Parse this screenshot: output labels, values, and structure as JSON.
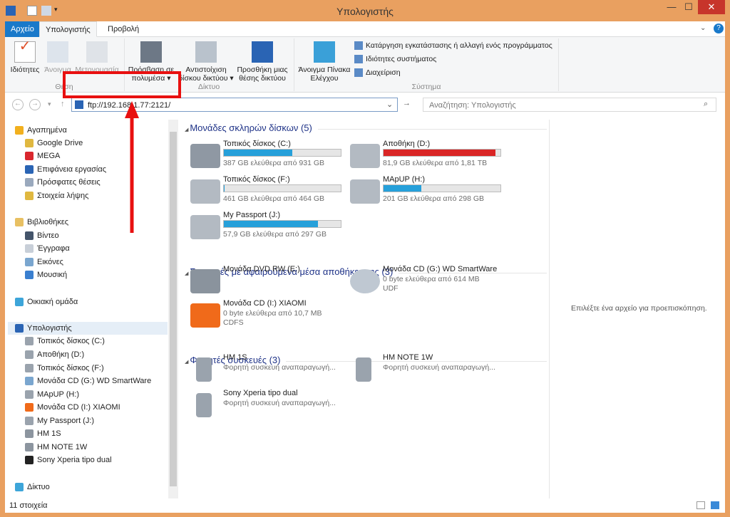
{
  "window": {
    "title": "Υπολογιστής",
    "minimize": "—",
    "maximize": "☐",
    "close": "✕"
  },
  "tabs": {
    "file": "Αρχείο",
    "computer": "Υπολογιστής",
    "view": "Προβολή"
  },
  "ribbon": {
    "location": {
      "label": "Θέση",
      "properties": "Ιδιότητες",
      "open": "Άνοιγμα",
      "rename": "Μετονομασία"
    },
    "network": {
      "label": "Δίκτυο",
      "media_1": "Πρόσβαση σε",
      "media_2": "πολυμέσα ▾",
      "map_1": "Αντιστοίχιση",
      "map_2": "δίσκου δικτύου ▾",
      "add_1": "Προσθήκη μιας",
      "add_2": "θέσης δικτύου"
    },
    "system": {
      "label": "Σύστημα",
      "cp_1": "Άνοιγμα Πίνακα",
      "cp_2": "Ελέγχου",
      "uninstall": "Κατάργηση εγκατάστασης ή αλλαγή ενός προγράμματος",
      "sysprops": "Ιδιότητες συστήματος",
      "manage": "Διαχείριση"
    }
  },
  "address": {
    "value": "ftp://192.168.1.77:2121/",
    "search_placeholder": "Αναζήτηση: Υπολογιστής"
  },
  "nav": [
    {
      "label": "Αγαπημένα",
      "icon": "star-icon",
      "color": "#f2b01e",
      "indent": 0
    },
    {
      "label": "Google Drive",
      "icon": "folder-icon",
      "color": "#e0b840",
      "indent": 1
    },
    {
      "label": "MEGA",
      "icon": "mega-icon",
      "color": "#d9272e",
      "indent": 1
    },
    {
      "label": "Επιφάνεια εργασίας",
      "icon": "desktop-icon",
      "color": "#2a64b4",
      "indent": 1
    },
    {
      "label": "Πρόσφατες θέσεις",
      "icon": "recent-icon",
      "color": "#9aa9bd",
      "indent": 1
    },
    {
      "label": "Στοιχεία λήψης",
      "icon": "downloads-icon",
      "color": "#e0b840",
      "indent": 1
    },
    {
      "label": "Βιβλιοθήκες",
      "icon": "library-icon",
      "color": "#e8c063",
      "indent": 0
    },
    {
      "label": "Βίντεο",
      "icon": "video-icon",
      "color": "#44546a",
      "indent": 1
    },
    {
      "label": "Έγγραφα",
      "icon": "documents-icon",
      "color": "#c8cfd8",
      "indent": 1
    },
    {
      "label": "Εικόνες",
      "icon": "pictures-icon",
      "color": "#7aa6cf",
      "indent": 1
    },
    {
      "label": "Μουσική",
      "icon": "music-icon",
      "color": "#3a7fcf",
      "indent": 1
    },
    {
      "label": "Οικιακή ομάδα",
      "icon": "homegroup-icon",
      "color": "#3da5d9",
      "indent": 0
    },
    {
      "label": "Υπολογιστής",
      "icon": "computer-icon",
      "color": "#2a64b4",
      "indent": 0,
      "selected": true
    },
    {
      "label": "Τοπικός δίσκος (C:)",
      "icon": "drive-icon",
      "color": "#9aa3ad",
      "indent": 1
    },
    {
      "label": "Αποθήκη (D:)",
      "icon": "drive-icon",
      "color": "#9aa3ad",
      "indent": 1
    },
    {
      "label": "Τοπικός δίσκος (F:)",
      "icon": "drive-icon",
      "color": "#9aa3ad",
      "indent": 1
    },
    {
      "label": "Μονάδα CD (G:) WD SmartWare",
      "icon": "cd-icon",
      "color": "#7aa6cf",
      "indent": 1
    },
    {
      "label": "MApUP (H:)",
      "icon": "drive-icon",
      "color": "#9aa3ad",
      "indent": 1
    },
    {
      "label": "Μονάδα CD (I:) XIAOMI",
      "icon": "xiaomi-icon",
      "color": "#f06a1a",
      "indent": 1
    },
    {
      "label": "My Passport (J:)",
      "icon": "drive-icon",
      "color": "#9aa3ad",
      "indent": 1
    },
    {
      "label": "HM 1S",
      "icon": "phone-icon",
      "color": "#8c959f",
      "indent": 1
    },
    {
      "label": "HM NOTE 1W",
      "icon": "phone-icon",
      "color": "#8c959f",
      "indent": 1
    },
    {
      "label": "Sony Xperia tipo dual",
      "icon": "phone-icon",
      "color": "#222222",
      "indent": 1
    },
    {
      "label": "Δίκτυο",
      "icon": "network-icon",
      "color": "#3da5d9",
      "indent": 0
    }
  ],
  "sections": [
    {
      "title": "Μονάδες σκληρών δίσκων (5)",
      "items": [
        {
          "name": "Τοπικός δίσκος (C:)",
          "sub": "387 GB ελεύθερα από 931 GB",
          "used": 0.584,
          "bar": "#26a0da",
          "icon": "windows-drive-icon"
        },
        {
          "name": "Αποθήκη (D:)",
          "sub": "81,9 GB ελεύθερα από 1,81 TB",
          "used": 0.956,
          "bar": "#da2626",
          "icon": "drive-icon"
        },
        {
          "name": "Τοπικός δίσκος (F:)",
          "sub": "461 GB ελεύθερα από 464 GB",
          "used": 0.006,
          "bar": "#26a0da",
          "icon": "drive-icon"
        },
        {
          "name": "MApUP (H:)",
          "sub": "201 GB ελεύθερα από 298 GB",
          "used": 0.326,
          "bar": "#26a0da",
          "icon": "drive-icon"
        },
        {
          "name": "My Passport (J:)",
          "sub": "57,9 GB ελεύθερα από 297 GB",
          "used": 0.805,
          "bar": "#26a0da",
          "icon": "drive-icon"
        }
      ]
    },
    {
      "title": "Συσκευές με αφαιρούμενα μέσα αποθήκευσης (3)",
      "items": [
        {
          "name": "Μονάδα DVD RW (E:)",
          "icon": "dvd-icon"
        },
        {
          "name": "Μονάδα CD (G:) WD SmartWare",
          "sub": "0 byte ελεύθερα από 614 MB",
          "sub2": "UDF",
          "icon": "cd-icon"
        },
        {
          "name": "Μονάδα CD (I:) XIAOMI",
          "sub": "0 byte ελεύθερα από 10,7 MB",
          "sub2": "CDFS",
          "icon": "xiaomi-icon"
        }
      ]
    },
    {
      "title": "Φορητές συσκευές (3)",
      "items": [
        {
          "name": "HM 1S",
          "sub": "Φορητή συσκευή αναπαραγωγή...",
          "icon": "phone-icon"
        },
        {
          "name": "HM NOTE 1W",
          "sub": "Φορητή συσκευή αναπαραγωγή...",
          "icon": "phone-icon"
        },
        {
          "name": "Sony Xperia tipo dual",
          "sub": "Φορητή συσκευή αναπαραγωγή...",
          "icon": "phone-icon"
        }
      ]
    }
  ],
  "preview": {
    "message": "Επιλέξτε ένα αρχείο για προεπισκόπηση."
  },
  "status": {
    "count": "11 στοιχεία"
  },
  "colors": {
    "frame": "#e9a060",
    "accent": "#1979ca",
    "highlight": "#e81010"
  }
}
